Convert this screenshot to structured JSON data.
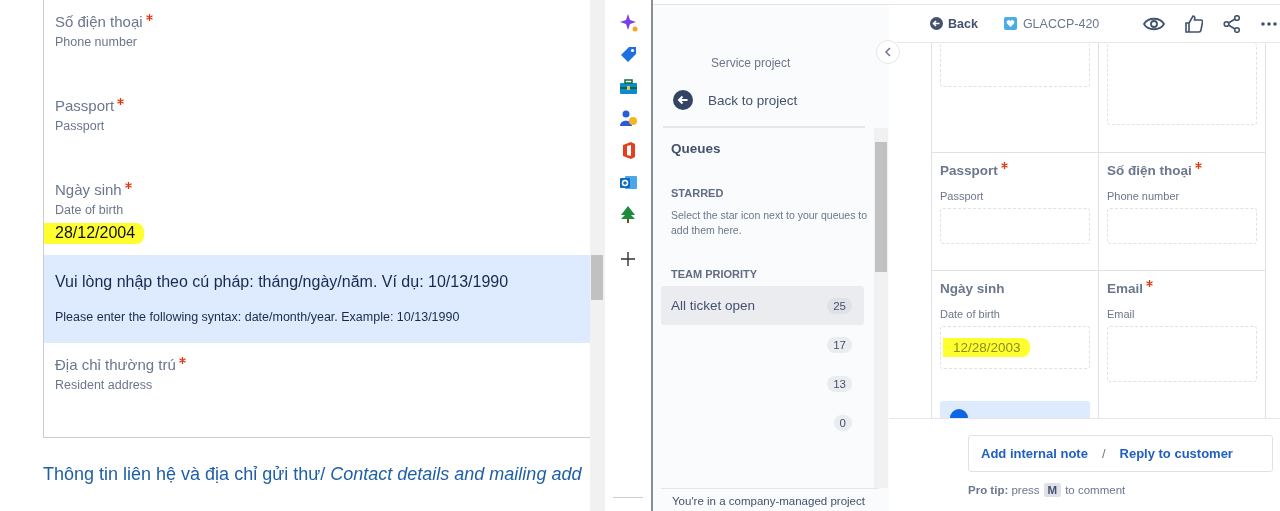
{
  "form": {
    "items": [
      {
        "kind": "field",
        "label": "Số điện thoại",
        "required": true,
        "hint": "Phone number"
      },
      {
        "kind": "field",
        "label": "Passport",
        "required": true,
        "hint": "Passport"
      },
      {
        "kind": "field",
        "label": "Ngày sinh",
        "required": true,
        "hint": "Date of birth",
        "value": "28/12/2004",
        "highlighted": true
      },
      {
        "kind": "notice",
        "title": "Vui lòng nhập theo cú pháp: tháng/ngày/năm. Ví dụ: 10/13/1990",
        "text": "Please enter the following syntax: date/month/year. Example: 10/13/1990"
      },
      {
        "kind": "field",
        "label": "Địa chỉ thường trú",
        "required": true,
        "hint": "Resident address"
      }
    ],
    "section_heading": "Thông tin liên hệ và địa chỉ gửi thư/ *Contact details and mailing add*"
  },
  "queue_sidebar": {
    "project_type": "Service project",
    "back_link": "Back to project",
    "title": "Queues",
    "starred": {
      "heading": "STARRED",
      "hint": "Select the star icon next to your queues to add them here."
    },
    "team_priority": {
      "heading": "TEAM PRIORITY",
      "queues": [
        {
          "name": "All ticket open",
          "count": "25",
          "selected": true
        },
        {
          "count": "17",
          "selected": false
        },
        {
          "count": "13",
          "selected": false
        },
        {
          "count": "0",
          "selected": false
        }
      ]
    },
    "footer": "You're in a company-managed project"
  },
  "issue": {
    "back": "Back",
    "key": "GLACCP-420",
    "fields": [
      {
        "label": "Passport",
        "required": true,
        "hint": "Passport"
      },
      {
        "label": "Số điện thoại",
        "required": true,
        "hint": "Phone number"
      },
      {
        "label": "Ngày sinh",
        "required": false,
        "hint": "Date of birth",
        "value": "12/28/2003",
        "highlighted": true,
        "notice": true
      },
      {
        "label": "Email",
        "required": true,
        "hint": "Email"
      }
    ],
    "comment": {
      "add_note": "Add internal note",
      "separator": "/",
      "reply": "Reply to customer",
      "tip": "**Pro tip:** press",
      "key": "M",
      "tip_end": "to comment"
    }
  }
}
